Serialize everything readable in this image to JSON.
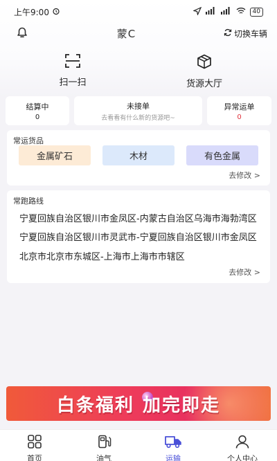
{
  "status_bar": {
    "time": "上午9:00",
    "battery": "40"
  },
  "header": {
    "plate": "蒙C",
    "switch_label": "切换车辆"
  },
  "quick_actions": [
    {
      "label": "扫一扫",
      "icon": "scan-icon"
    },
    {
      "label": "货源大厅",
      "icon": "box-icon"
    }
  ],
  "stats": {
    "settling": {
      "title": "结算中",
      "value": "0"
    },
    "pending": {
      "title": "未接单",
      "subtitle": "去看看有什么新的货源吧~"
    },
    "abnormal": {
      "title": "异常运单",
      "value": "0"
    }
  },
  "goods": {
    "title": "常运货品",
    "items": [
      "金属矿石",
      "木材",
      "有色金属"
    ],
    "modify": "去修改 >"
  },
  "routes": {
    "title": "常跑路线",
    "items": [
      "宁夏回族自治区银川市金凤区-内蒙古自治区乌海市海勃湾区",
      "宁夏回族自治区银川市灵武市-宁夏回族自治区银川市金凤区",
      "北京市北京市东城区-上海市上海市市辖区"
    ],
    "modify": "去修改 >"
  },
  "banner": {
    "left": "白条福利",
    "right": "加完即走"
  },
  "tabs": [
    {
      "label": "首页",
      "icon": "home-grid-icon",
      "active": false
    },
    {
      "label": "油气",
      "icon": "fuel-icon",
      "active": false
    },
    {
      "label": "运输",
      "icon": "truck-icon",
      "active": true
    },
    {
      "label": "个人中心",
      "icon": "user-icon",
      "active": false
    }
  ],
  "colors": {
    "accent": "#4a50d8",
    "chip_orange": "#fdebd6",
    "chip_blue": "#dce9fb",
    "chip_purple": "#d9dbfb",
    "alert_red": "#e0323c"
  }
}
